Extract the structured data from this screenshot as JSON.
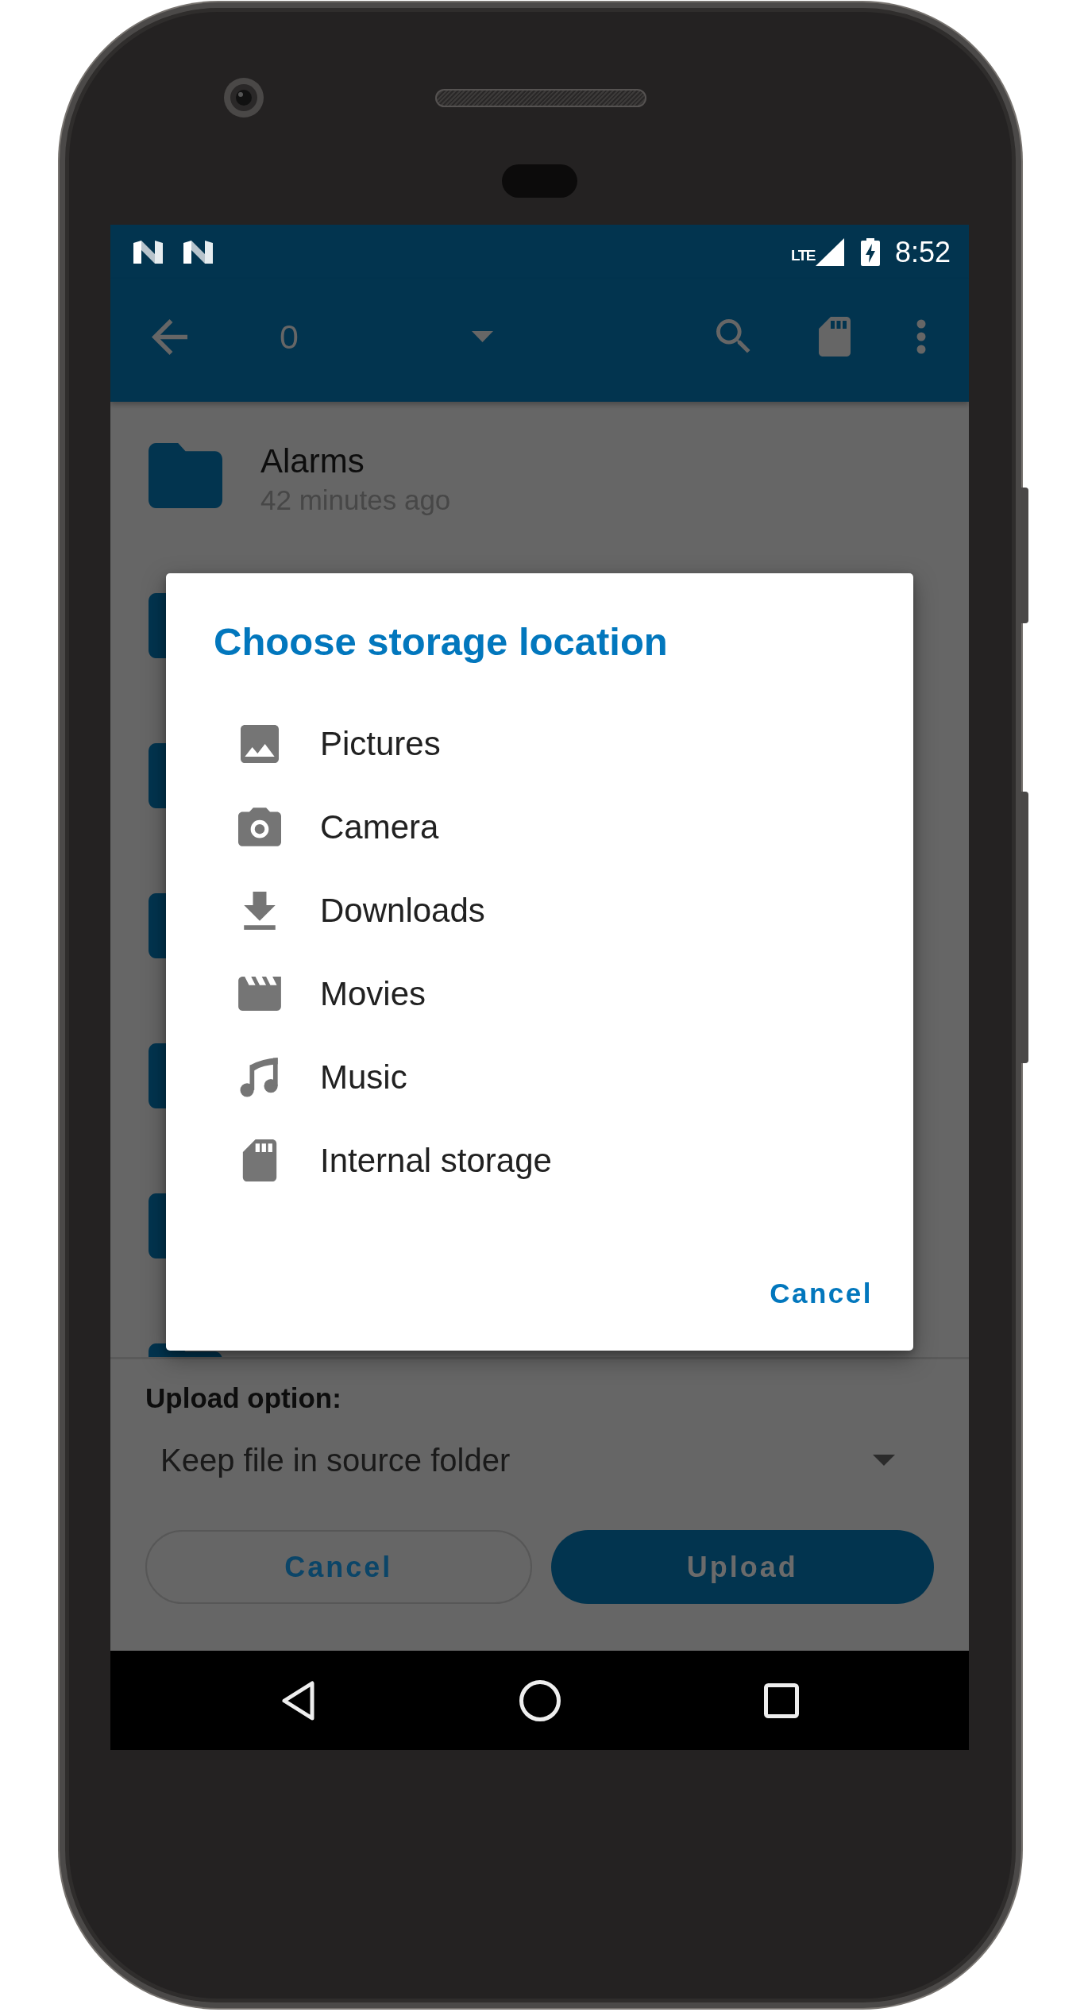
{
  "status_bar": {
    "network": "LTE",
    "time": "8:52"
  },
  "toolbar": {
    "selector": "0"
  },
  "folders": [
    {
      "kind": "folder",
      "name": "Alarms",
      "modified": "42 minutes ago"
    },
    {
      "kind": "folder"
    },
    {
      "kind": "folder"
    },
    {
      "kind": "folder"
    },
    {
      "kind": "folder"
    },
    {
      "kind": "folder"
    },
    {
      "kind": "folder"
    }
  ],
  "dialog": {
    "title": "Choose storage location",
    "options": [
      "Pictures",
      "Camera",
      "Downloads",
      "Movies",
      "Music",
      "Internal storage"
    ],
    "action": "Cancel"
  },
  "upload_panel": {
    "label": "Upload option:",
    "selection": "Keep file in source folder",
    "buttons": [
      {
        "label": "Cancel",
        "kind": "outlined"
      },
      {
        "label": "Upload",
        "kind": "filled"
      }
    ]
  }
}
